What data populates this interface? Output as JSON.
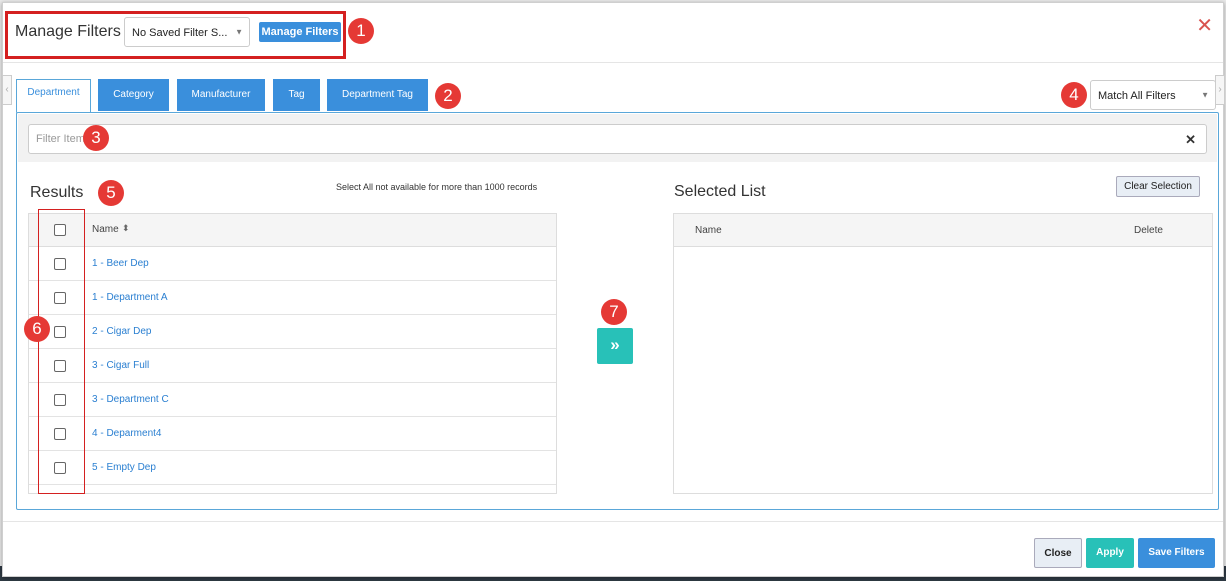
{
  "header": {
    "title": "Manage Filters",
    "saved_filter_select": "No Saved Filter S...",
    "manage_filters_button": "Manage Filters",
    "close_glyph": "✕"
  },
  "annotations": [
    "1",
    "2",
    "3",
    "4",
    "5",
    "6",
    "7"
  ],
  "tabs": [
    "Department",
    "Category",
    "Manufacturer",
    "Tag",
    "Department Tag"
  ],
  "match_select": "Match All Filters",
  "filter": {
    "placeholder": "Filter Item",
    "clear_glyph": "✕"
  },
  "results": {
    "title": "Results",
    "note": "Select All not available for more than 1000 records",
    "column_name": "Name",
    "sort_glyph": "⬍",
    "rows": [
      "1 - Beer Dep",
      "1 - Department A",
      "2 - Cigar Dep",
      "3 - Cigar Full",
      "3 - Department C",
      "4 - Deparment4",
      "5 - Empty Dep"
    ]
  },
  "move_button": "»",
  "selected": {
    "title": "Selected List",
    "clear_button": "Clear Selection",
    "column_name": "Name",
    "column_delete": "Delete"
  },
  "footer": {
    "close": "Close",
    "apply": "Apply",
    "save": "Save Filters"
  },
  "colors": {
    "accent": "#3a8fdc",
    "teal": "#28c1b8",
    "badge": "#e53935",
    "highlight": "#d42020"
  }
}
